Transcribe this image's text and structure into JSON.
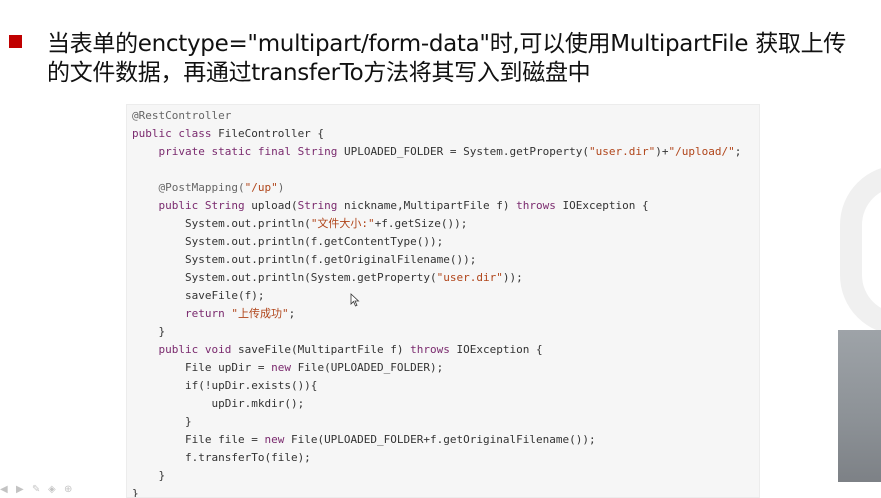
{
  "heading": {
    "line1": "当表单的enctype=\"multipart/form-data\"时,可以使用MultipartFile 获取上传",
    "line2": "的文件数据，再通过transferTo方法将其写入到磁盘中"
  },
  "code": {
    "l1": "@RestController",
    "l2a": "public class ",
    "l2b": "FileController {",
    "l3a": "    private static final ",
    "l3b": "String",
    "l3c": " UPLOADED_FOLDER = System.getProperty(",
    "l3d": "\"user.dir\"",
    "l3e": ")+",
    "l3f": "\"/upload/\"",
    "l3g": ";",
    "l5a": "    @PostMapping(",
    "l5b": "\"/up\"",
    "l5c": ")",
    "l6a": "    public ",
    "l6b": "String",
    "l6c": " upload(",
    "l6d": "String",
    "l6e": " nickname,MultipartFile f) ",
    "l6f": "throws",
    "l6g": " IOException {",
    "l7a": "        System.out.println(",
    "l7b": "\"文件大小:\"",
    "l7c": "+f.getSize());",
    "l8": "        System.out.println(f.getContentType());",
    "l9": "        System.out.println(f.getOriginalFilename());",
    "l10a": "        System.out.println(System.getProperty(",
    "l10b": "\"user.dir\"",
    "l10c": "));",
    "l11": "        saveFile(f);",
    "l12a": "        return ",
    "l12b": "\"上传成功\"",
    "l12c": ";",
    "l13": "    }",
    "l14a": "    public void ",
    "l14b": "saveFile(MultipartFile f) ",
    "l14c": "throws",
    "l14d": " IOException {",
    "l15a": "        File upDir = ",
    "l15b": "new",
    "l15c": " File(UPLOADED_FOLDER);",
    "l16": "        if(!upDir.exists()){",
    "l17": "            upDir.mkdir();",
    "l18": "        }",
    "l19a": "        File file = ",
    "l19b": "new",
    "l19c": " File(UPLOADED_FOLDER+f.getOriginalFilename());",
    "l20": "        f.transferTo(file);",
    "l21": "    }",
    "l22": "}"
  },
  "colors": {
    "bullet": "#c00000",
    "keyword": "#7a2a6e",
    "string": "#b0451a"
  },
  "icons": [
    "mouse-cursor-icon",
    "presenter-toolbar-icons"
  ]
}
